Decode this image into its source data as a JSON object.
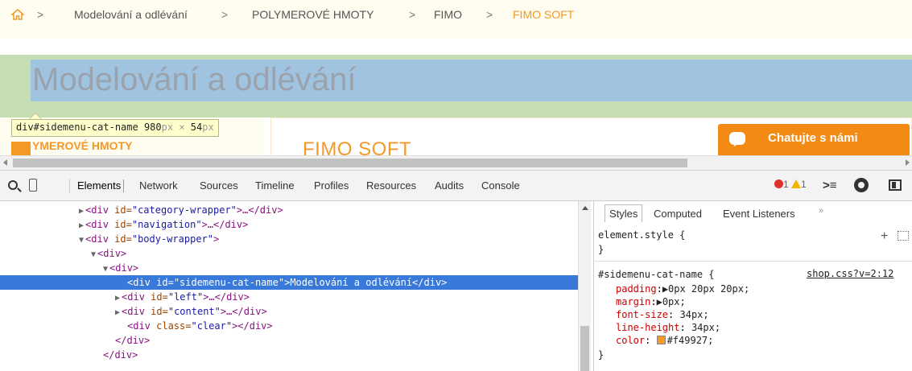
{
  "breadcrumb": {
    "items": [
      "Modelování a odlévání",
      "POLYMEROVÉ HMOTY",
      "FIMO",
      "FIMO SOFT"
    ],
    "separator": ">"
  },
  "page": {
    "category_title": "Modelování a odlévání",
    "left_label": "YMEROVÉ HMOTY",
    "content_title": "FIMO SOFT",
    "chat_label": "Chatujte s námi",
    "accent_color": "#f49927"
  },
  "tooltip": {
    "selector": "div#sidemenu-cat-name",
    "width": "980",
    "height": "54",
    "unit": "px",
    "times": "×"
  },
  "devtools": {
    "tabs": [
      "Elements",
      "Network",
      "Sources",
      "Timeline",
      "Profiles",
      "Resources",
      "Audits",
      "Console"
    ],
    "active_tab": "Elements",
    "error_count": "1",
    "warning_count": "1",
    "tree": [
      {
        "tri": "▶",
        "open": "<div ",
        "attr": "id=",
        "val": "\"category-wrapper\"",
        "rest": ">…</div>"
      },
      {
        "tri": "▶",
        "open": "<div ",
        "attr": "id=",
        "val": "\"navigation\"",
        "rest": ">…</div>"
      },
      {
        "tri": "▼",
        "open": "<div ",
        "attr": "id=",
        "val": "\"body-wrapper\"",
        "rest": ">"
      },
      {
        "tri": "▼",
        "open": "<div>",
        "attr": "",
        "val": "",
        "rest": ""
      },
      {
        "tri": "▼",
        "open": "<div>",
        "attr": "",
        "val": "",
        "rest": ""
      },
      {
        "tri": "",
        "open": "<div ",
        "attr": "id=",
        "val": "\"sidemenu-cat-name\"",
        "rest": ">",
        "text": "Modelování a odlévání",
        "close": "</div>"
      },
      {
        "tri": "▶",
        "open": "<div ",
        "attr": "id=",
        "val": "\"left\"",
        "rest": ">…</div>"
      },
      {
        "tri": "▶",
        "open": "<div ",
        "attr": "id=",
        "val": "\"content\"",
        "rest": ">…</div>"
      },
      {
        "tri": "",
        "open": "<div ",
        "attr": "class=",
        "val": "\"clear\"",
        "rest": "></div>"
      },
      {
        "tri": "",
        "open": "</div>",
        "attr": "",
        "val": "",
        "rest": ""
      },
      {
        "tri": "",
        "open": "</div>",
        "attr": "",
        "val": "",
        "rest": ""
      }
    ],
    "styles": {
      "tabs": [
        "Styles",
        "Computed",
        "Event Listeners"
      ],
      "more": "»",
      "element_style": "element.style {",
      "close_brace": "}",
      "rule_selector": "#sidemenu-cat-name {",
      "rule_source": "shop.css?v=2:12",
      "props": [
        {
          "name": "padding",
          "value": "▶0px 20px 20px;"
        },
        {
          "name": "margin",
          "value": "▶0px;"
        },
        {
          "name": "font-size",
          "value": " 34px;"
        },
        {
          "name": "line-height",
          "value": " 34px;"
        },
        {
          "name": "color",
          "value": "#f49927;",
          "swatch": "#f49927"
        }
      ]
    }
  }
}
